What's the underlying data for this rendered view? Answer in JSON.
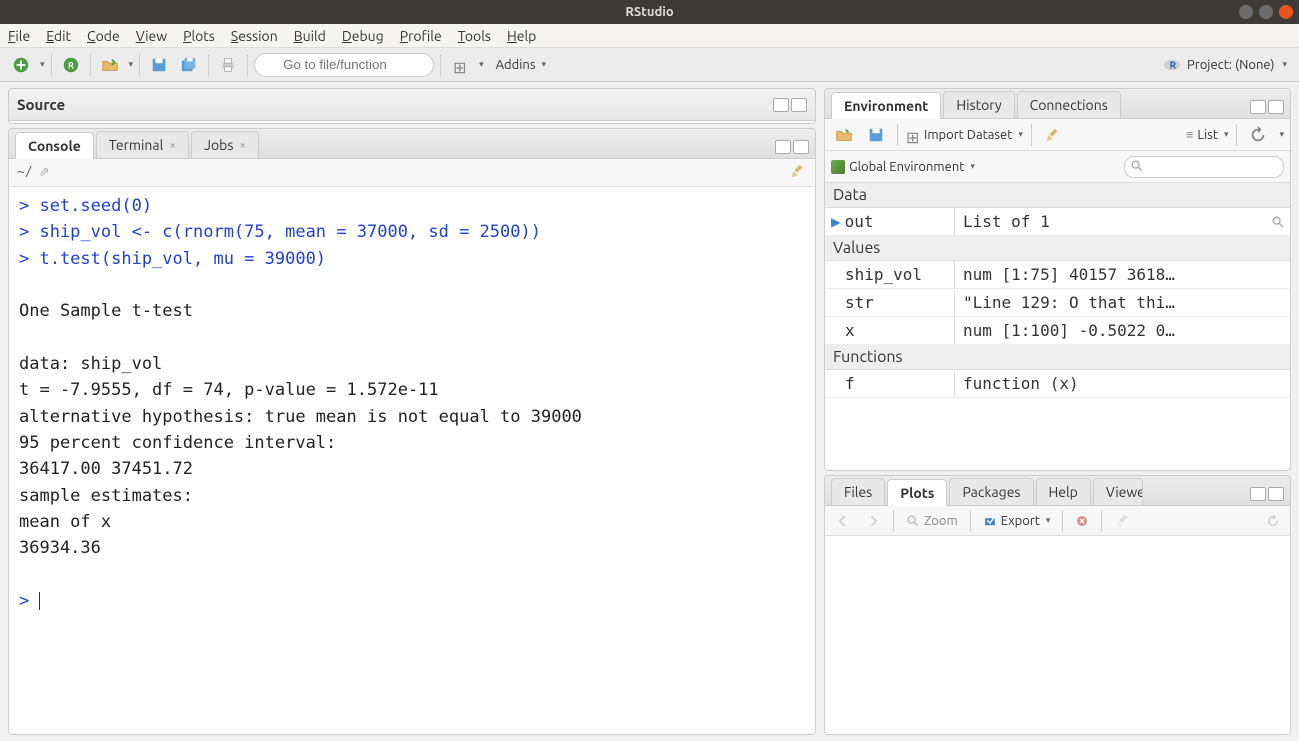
{
  "window": {
    "title": "RStudio"
  },
  "menubar": [
    "File",
    "Edit",
    "Code",
    "View",
    "Plots",
    "Session",
    "Build",
    "Debug",
    "Profile",
    "Tools",
    "Help"
  ],
  "toolbar": {
    "goto_placeholder": "Go to file/function",
    "addins": "Addins",
    "project_label": "Project: (None)"
  },
  "source": {
    "title": "Source"
  },
  "console": {
    "tabs": {
      "console": "Console",
      "terminal": "Terminal",
      "jobs": "Jobs"
    },
    "path": "~/",
    "lines": [
      {
        "type": "input",
        "text": "> set.seed(0)"
      },
      {
        "type": "input",
        "text": "> ship_vol <- c(rnorm(75, mean = 37000, sd = 2500))"
      },
      {
        "type": "input",
        "text": "> t.test(ship_vol, mu = 39000)"
      },
      {
        "type": "output",
        "text": ""
      },
      {
        "type": "output",
        "text": "        One Sample t-test"
      },
      {
        "type": "output",
        "text": ""
      },
      {
        "type": "output",
        "text": "data:  ship_vol"
      },
      {
        "type": "output",
        "text": "t = -7.9555, df = 74, p-value = 1.572e-11"
      },
      {
        "type": "output",
        "text": "alternative hypothesis: true mean is not equal to 39000"
      },
      {
        "type": "output",
        "text": "95 percent confidence interval:"
      },
      {
        "type": "output",
        "text": " 36417.00 37451.72"
      },
      {
        "type": "output",
        "text": "sample estimates:"
      },
      {
        "type": "output",
        "text": "mean of x "
      },
      {
        "type": "output",
        "text": " 36934.36 "
      },
      {
        "type": "output",
        "text": ""
      },
      {
        "type": "input",
        "text": "> "
      }
    ]
  },
  "environment": {
    "tabs": {
      "env": "Environment",
      "history": "History",
      "connections": "Connections"
    },
    "import": "Import Dataset",
    "list": "List",
    "scope": "Global Environment",
    "sections": {
      "data": {
        "label": "Data",
        "rows": [
          {
            "name": "out",
            "value": "List of 1",
            "expandable": true,
            "inspect": true
          }
        ]
      },
      "values": {
        "label": "Values",
        "rows": [
          {
            "name": "ship_vol",
            "value": "num [1:75] 40157 3618…"
          },
          {
            "name": "str",
            "value": "\"Line 129: O that thi…"
          },
          {
            "name": "x",
            "value": "num [1:100] -0.5022 0…"
          }
        ]
      },
      "functions": {
        "label": "Functions",
        "rows": [
          {
            "name": "f",
            "value": "function (x)"
          }
        ]
      }
    }
  },
  "plots": {
    "tabs": {
      "files": "Files",
      "plots": "Plots",
      "packages": "Packages",
      "help": "Help",
      "viewer": "Viewer"
    },
    "zoom": "Zoom",
    "export": "Export"
  }
}
